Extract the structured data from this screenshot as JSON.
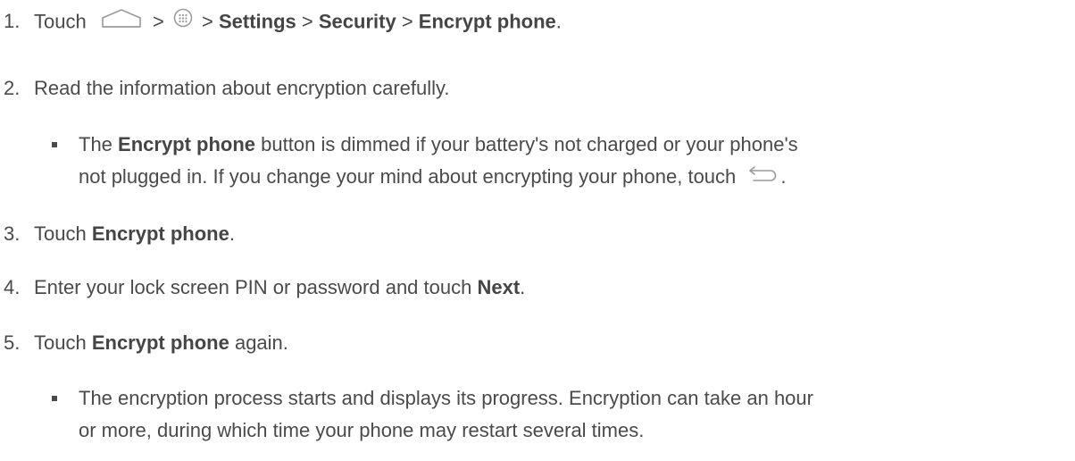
{
  "steps": [
    {
      "number": "1.",
      "prefix": "Touch",
      "icons": [
        "home-icon",
        "apps-icon"
      ],
      "sep1": " > ",
      "sep2": " > ",
      "settings": "Settings",
      "sep3": " > ",
      "security": "Security",
      "sep4": " > ",
      "encrypt": "Encrypt phone",
      "end": "."
    },
    {
      "number": "2.",
      "text": "Read the information about encryption carefully."
    },
    {
      "number": "3.",
      "pre": "Touch ",
      "bold": "Encrypt phone",
      "post": "."
    },
    {
      "number": "4.",
      "pre": "Enter your lock screen PIN or password and touch ",
      "bold": "Next",
      "post": "."
    },
    {
      "number": "5.",
      "pre": "Touch ",
      "bold": "Encrypt phone",
      "post": " again."
    }
  ],
  "bullets": [
    {
      "pre": "The ",
      "bold": "Encrypt phone",
      "post": " button is dimmed if your battery's not charged or your phone's",
      "line2": "not plugged in. If you change your mind about encrypting your phone, touch",
      "icon": "back-icon",
      "end": "."
    },
    {
      "line1": "The encryption process starts and displays its progress. Encryption can take an hour",
      "line2": "or more, during which time your phone may restart several times."
    }
  ]
}
